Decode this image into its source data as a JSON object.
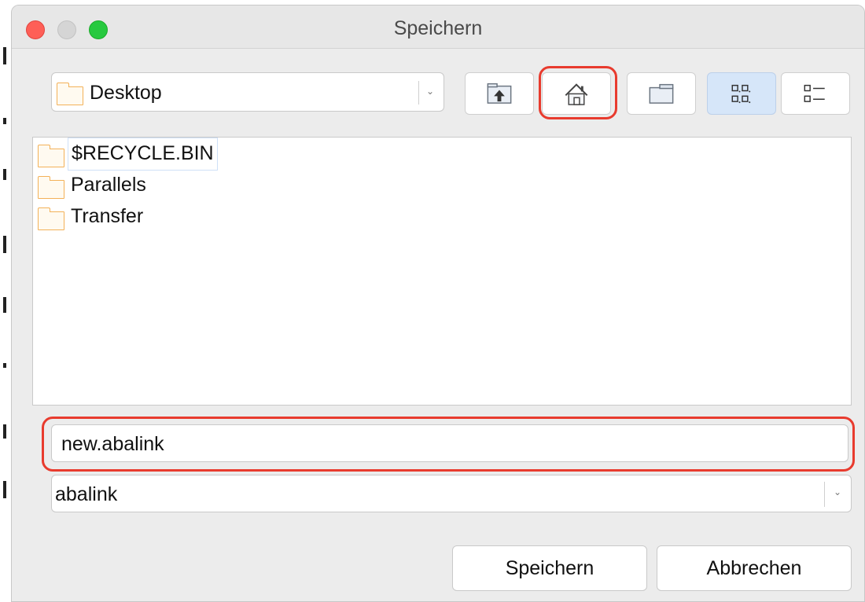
{
  "window": {
    "title": "Speichern"
  },
  "toolbar": {
    "location": "Desktop",
    "buttons": [
      {
        "name": "parent-folder",
        "icon": "folder-up-icon"
      },
      {
        "name": "home",
        "icon": "home-icon"
      },
      {
        "name": "new-folder",
        "icon": "new-folder-icon"
      },
      {
        "name": "icon-view",
        "icon": "icon-view-icon",
        "active": true
      },
      {
        "name": "list-view",
        "icon": "list-view-icon",
        "active": false
      }
    ]
  },
  "files": {
    "items": [
      {
        "name": "$RECYCLE.BIN",
        "type": "folder"
      },
      {
        "name": "Parallels",
        "type": "folder"
      },
      {
        "name": "Transfer",
        "type": "folder"
      }
    ]
  },
  "filename": {
    "value": "new.abalink"
  },
  "filetype": {
    "value": "abalink"
  },
  "actions": {
    "save_label": "Speichern",
    "cancel_label": "Abbrechen"
  },
  "colors": {
    "highlight": "#e83b2e",
    "folder": "#f3b158",
    "active_view": "#d6e6f9",
    "close": "#fe5f57",
    "maximize": "#27c93f"
  }
}
